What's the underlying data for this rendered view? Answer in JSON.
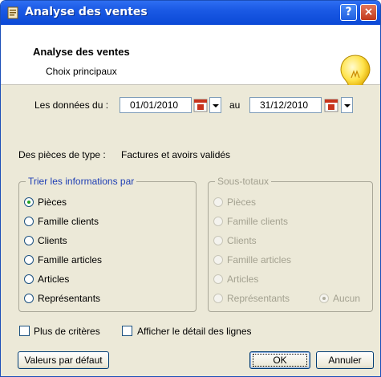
{
  "window": {
    "title": "Analyse des ventes",
    "help_label": "?",
    "close_label": "×"
  },
  "header": {
    "title": "Analyse des ventes",
    "subtitle": "Choix principaux"
  },
  "dates": {
    "from_label": "Les données du :",
    "from_value": "01/01/2010",
    "to_label": "au",
    "to_value": "31/12/2010"
  },
  "pieces": {
    "label": "Des pièces de type :",
    "value": "Factures et avoirs validés"
  },
  "sort_group": {
    "title": "Trier les informations par",
    "options": [
      "Pièces",
      "Famille clients",
      "Clients",
      "Famille articles",
      "Articles",
      "Représentants"
    ],
    "selected": "Pièces"
  },
  "subtotal_group": {
    "title": "Sous-totaux",
    "options": [
      "Pièces",
      "Famille clients",
      "Clients",
      "Famille articles",
      "Articles",
      "Représentants"
    ],
    "extra_option": "Aucun",
    "selected": "Aucun"
  },
  "checkboxes": {
    "more_criteria": "Plus de critères",
    "show_details": "Afficher le détail des lignes"
  },
  "buttons": {
    "defaults": "Valeurs par défaut",
    "ok": "OK",
    "cancel": "Annuler"
  },
  "colors": {
    "titlebar": "#0b49d6",
    "group_title": "#1f3fb4",
    "disabled_text": "#a3a190"
  },
  "icons": {
    "app": "document-icon",
    "bulb": "lightbulb-icon",
    "calendar": "calendar-icon"
  }
}
